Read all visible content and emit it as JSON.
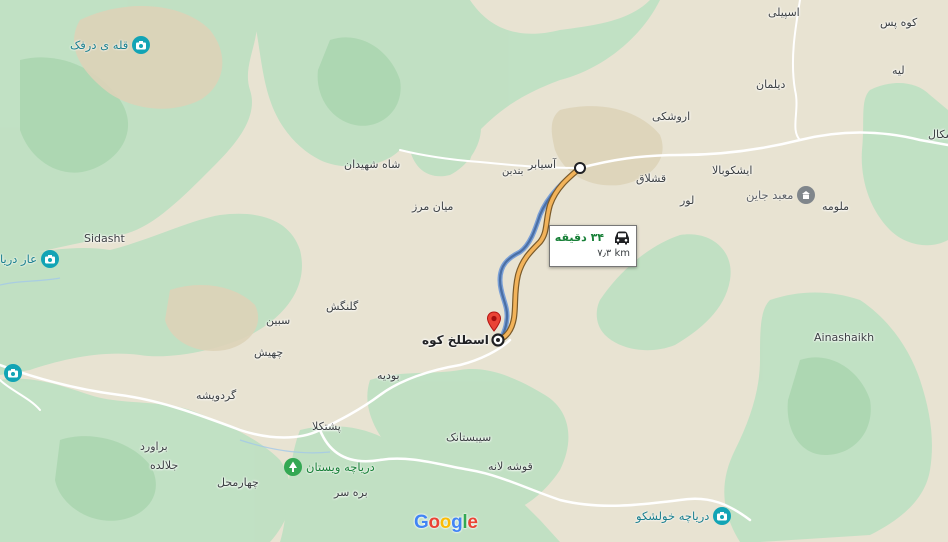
{
  "map": {
    "labels": {
      "espili": "اسپیلی",
      "kuh_pas": "کوه پس",
      "liyeh": "لیه",
      "deylaman": "دیلمان",
      "urushki": "اروشکی",
      "shah_shahidan": "شاه شهیدان",
      "asiabar": "آسیابر",
      "bandbon": "بندبن",
      "gheshlagh": "قشلاق",
      "eshkubala": "ایشکوبالا",
      "lor": "لور",
      "malume": "ملومه",
      "miyan_marz": "میان مرز",
      "sidasht": "Sidasht",
      "golangesh": "گلنگش",
      "sebin": "سبین",
      "chehesh": "چهیش",
      "estalakh_kuh": "اسطلخ کوه",
      "budeh": "بودیه",
      "gerduvisheh": "گردویشه",
      "poshtkela": "پشتکلا",
      "sibestanak": "سیبستانک",
      "baravard": "براورد",
      "jalaldeh": "جلالده",
      "gushe_laneh": "قوشه لانه",
      "chaharmahal": "چهارمحل",
      "bareh_sar": "بره سر",
      "ainashaikh": "Ainashaikh",
      "eshkal_partial": "شکال"
    },
    "pois": {
      "qaleh_darfak": "قله ی درفک",
      "aar_darya_partial": "عار دریا",
      "mabad_jain": "معبد جاین",
      "darya_vistan": "دریاچه ویستان",
      "darya_khulshku": "دریاچه خولشکو"
    },
    "route": {
      "duration": "۳۴ دقیقه",
      "distance": "۷٫۳ km",
      "start_icon": "circle-start-icon",
      "end_icon": "destination-pin-icon",
      "mode_icon": "car-icon",
      "colors": {
        "primary": "#f2b35a",
        "alternate": "#4a6fa5"
      }
    },
    "logo": {
      "letters": [
        "G",
        "o",
        "o",
        "g",
        "l",
        "e"
      ],
      "colors": [
        "#4285F4",
        "#EA4335",
        "#FBBC05",
        "#4285F4",
        "#34A853",
        "#EA4335"
      ]
    }
  }
}
